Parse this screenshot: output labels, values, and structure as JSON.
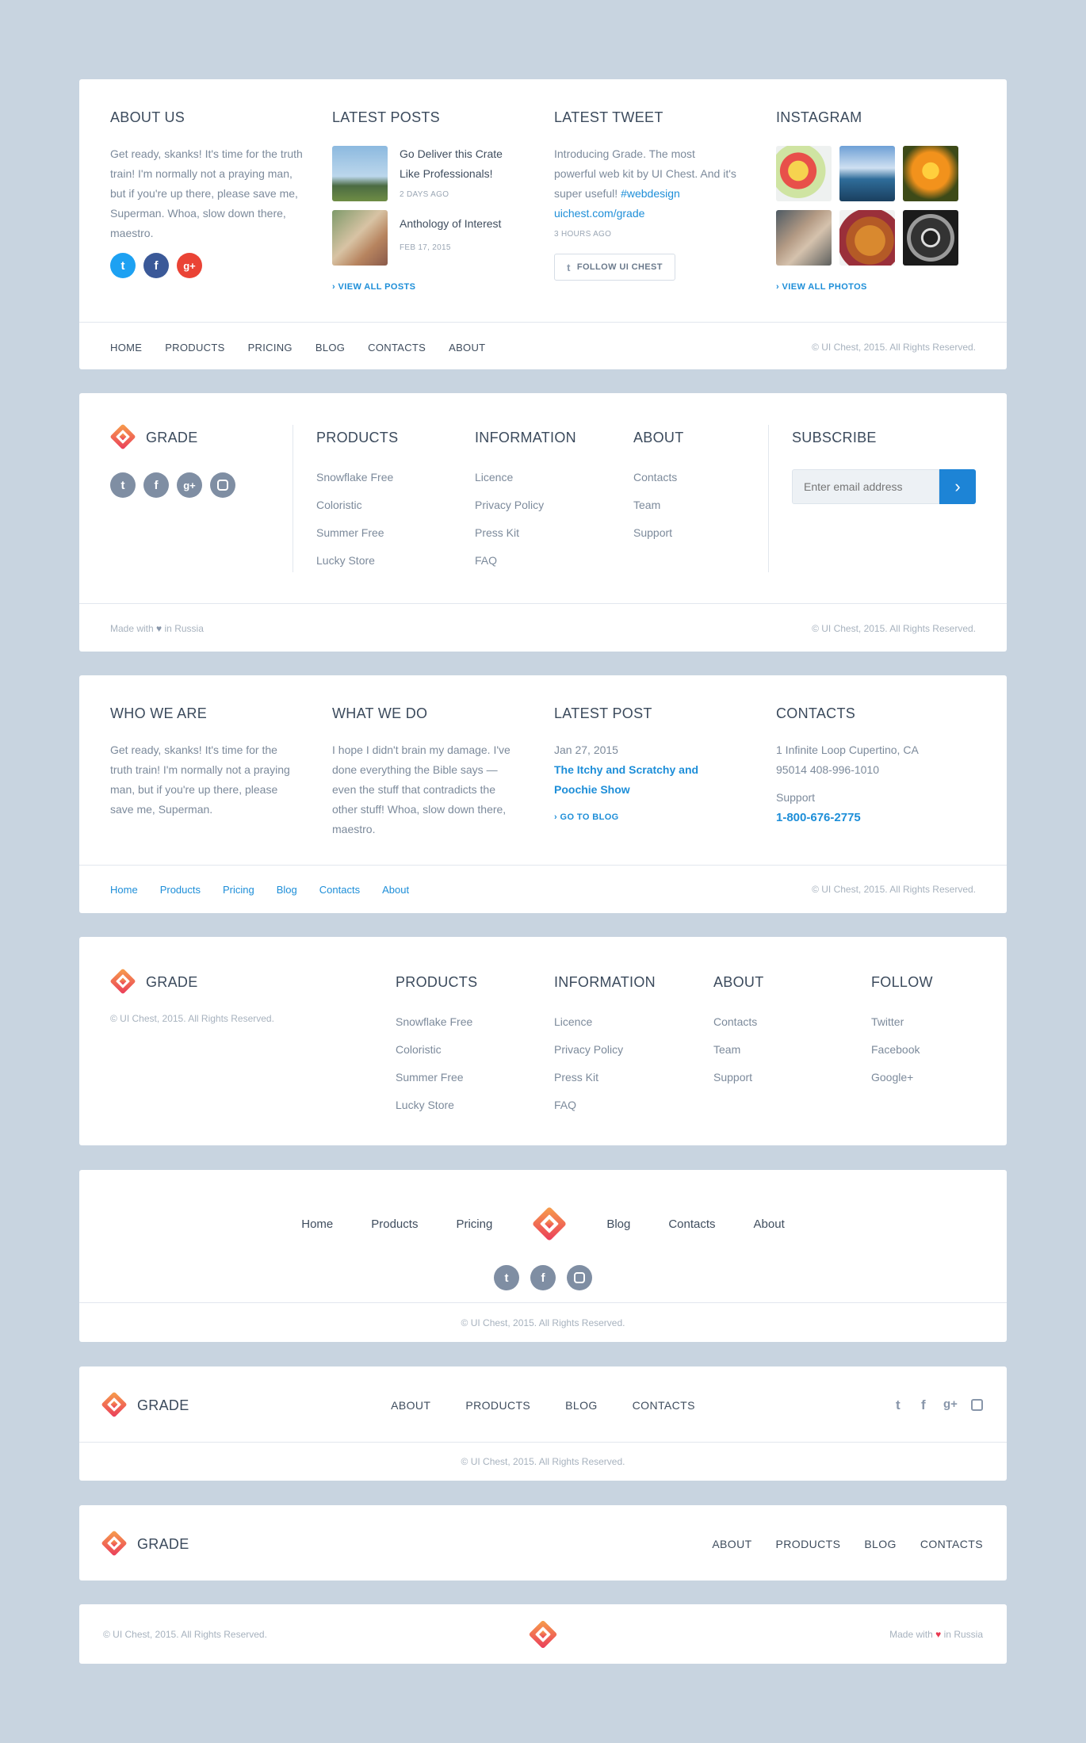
{
  "footer1": {
    "about": {
      "title": "ABOUT US",
      "text": "Get ready, skanks! It's time for the truth train! I'm normally not a praying man, but if you're up there, please save me, Superman. Whoa, slow down there, maestro."
    },
    "posts": {
      "title": "LATEST POSTS",
      "items": [
        {
          "title": "Go Deliver this Crate Like Professionals!",
          "date": "2 DAYS AGO"
        },
        {
          "title": "Anthology of Interest",
          "date": "FEB 17, 2015"
        }
      ],
      "more": "VIEW ALL POSTS"
    },
    "tweet": {
      "title": "LATEST TWEET",
      "text": "Introducing Grade. The most powerful web kit by UI Chest. And it's super useful!",
      "hashtag": "#webdesign",
      "url": "uichest.com/grade",
      "time": "3 HOURS AGO",
      "follow": "FOLLOW UI CHEST"
    },
    "instagram": {
      "title": "INSTAGRAM",
      "more": "VIEW ALL PHOTOS"
    },
    "nav": [
      "HOME",
      "PRODUCTS",
      "PRICING",
      "BLOG",
      "CONTACTS",
      "ABOUT"
    ],
    "copyright": "© UI Chest, 2015. All Rights Reserved."
  },
  "footer2": {
    "brand": "GRADE",
    "products": {
      "title": "PRODUCTS",
      "items": [
        "Snowflake Free",
        "Coloristic",
        "Summer Free",
        "Lucky Store"
      ]
    },
    "information": {
      "title": "INFORMATION",
      "items": [
        "Licence",
        "Privacy Policy",
        "Press Kit",
        "FAQ"
      ]
    },
    "about": {
      "title": "ABOUT",
      "items": [
        "Contacts",
        "Team",
        "Support"
      ]
    },
    "subscribe": {
      "title": "SUBSCRIBE",
      "placeholder": "Enter email address"
    },
    "made_pre": "Made with",
    "made_post": "in Russia",
    "copyright": "© UI Chest, 2015. All Rights Reserved."
  },
  "footer3": {
    "who": {
      "title": "WHO WE ARE",
      "text": "Get ready, skanks! It's time for the truth train! I'm normally not a praying man, but if you're up there, please save me, Superman."
    },
    "what": {
      "title": "WHAT WE DO",
      "text": "I hope I didn't brain my damage. I've done everything the Bible says — even the stuff that contradicts the other stuff! Whoa, slow down there, maestro."
    },
    "post": {
      "title": "LATEST POST",
      "date": "Jan 27, 2015",
      "link": "The Itchy and Scratchy and Poochie Show",
      "more": "GO TO BLOG"
    },
    "contacts": {
      "title": "CONTACTS",
      "address": "1 Infinite Loop Cupertino, CA 95014 408-996-1010",
      "support_label": "Support",
      "phone": "1-800-676-2775"
    },
    "nav": [
      "Home",
      "Products",
      "Pricing",
      "Blog",
      "Contacts",
      "About"
    ],
    "copyright": "© UI Chest, 2015. All Rights Reserved."
  },
  "footer4": {
    "brand": "GRADE",
    "copyright": "© UI Chest, 2015. All Rights Reserved.",
    "products": {
      "title": "PRODUCTS",
      "items": [
        "Snowflake Free",
        "Coloristic",
        "Summer Free",
        "Lucky Store"
      ]
    },
    "information": {
      "title": "INFORMATION",
      "items": [
        "Licence",
        "Privacy Policy",
        "Press Kit",
        "FAQ"
      ]
    },
    "about": {
      "title": "ABOUT",
      "items": [
        "Contacts",
        "Team",
        "Support"
      ]
    },
    "follow": {
      "title": "FOLLOW",
      "items": [
        "Twitter",
        "Facebook",
        "Google+"
      ]
    }
  },
  "footer5": {
    "nav_left": [
      "Home",
      "Products",
      "Pricing"
    ],
    "nav_right": [
      "Blog",
      "Contacts",
      "About"
    ],
    "copyright": "© UI Chest, 2015. All Rights Reserved."
  },
  "footer6": {
    "brand": "GRADE",
    "nav": [
      "ABOUT",
      "PRODUCTS",
      "BLOG",
      "CONTACTS"
    ],
    "copyright": "© UI Chest, 2015. All Rights Reserved."
  },
  "footer7": {
    "brand": "GRADE",
    "nav": [
      "ABOUT",
      "PRODUCTS",
      "BLOG",
      "CONTACTS"
    ]
  },
  "footer8": {
    "copyright": "© UI Chest, 2015. All Rights Reserved.",
    "made_pre": "Made with",
    "made_post": "in Russia"
  },
  "colors": {
    "accent": "#1d8ed8",
    "background": "#c8d4e0",
    "logo": "#f0574f",
    "heart": "#e8384f"
  }
}
